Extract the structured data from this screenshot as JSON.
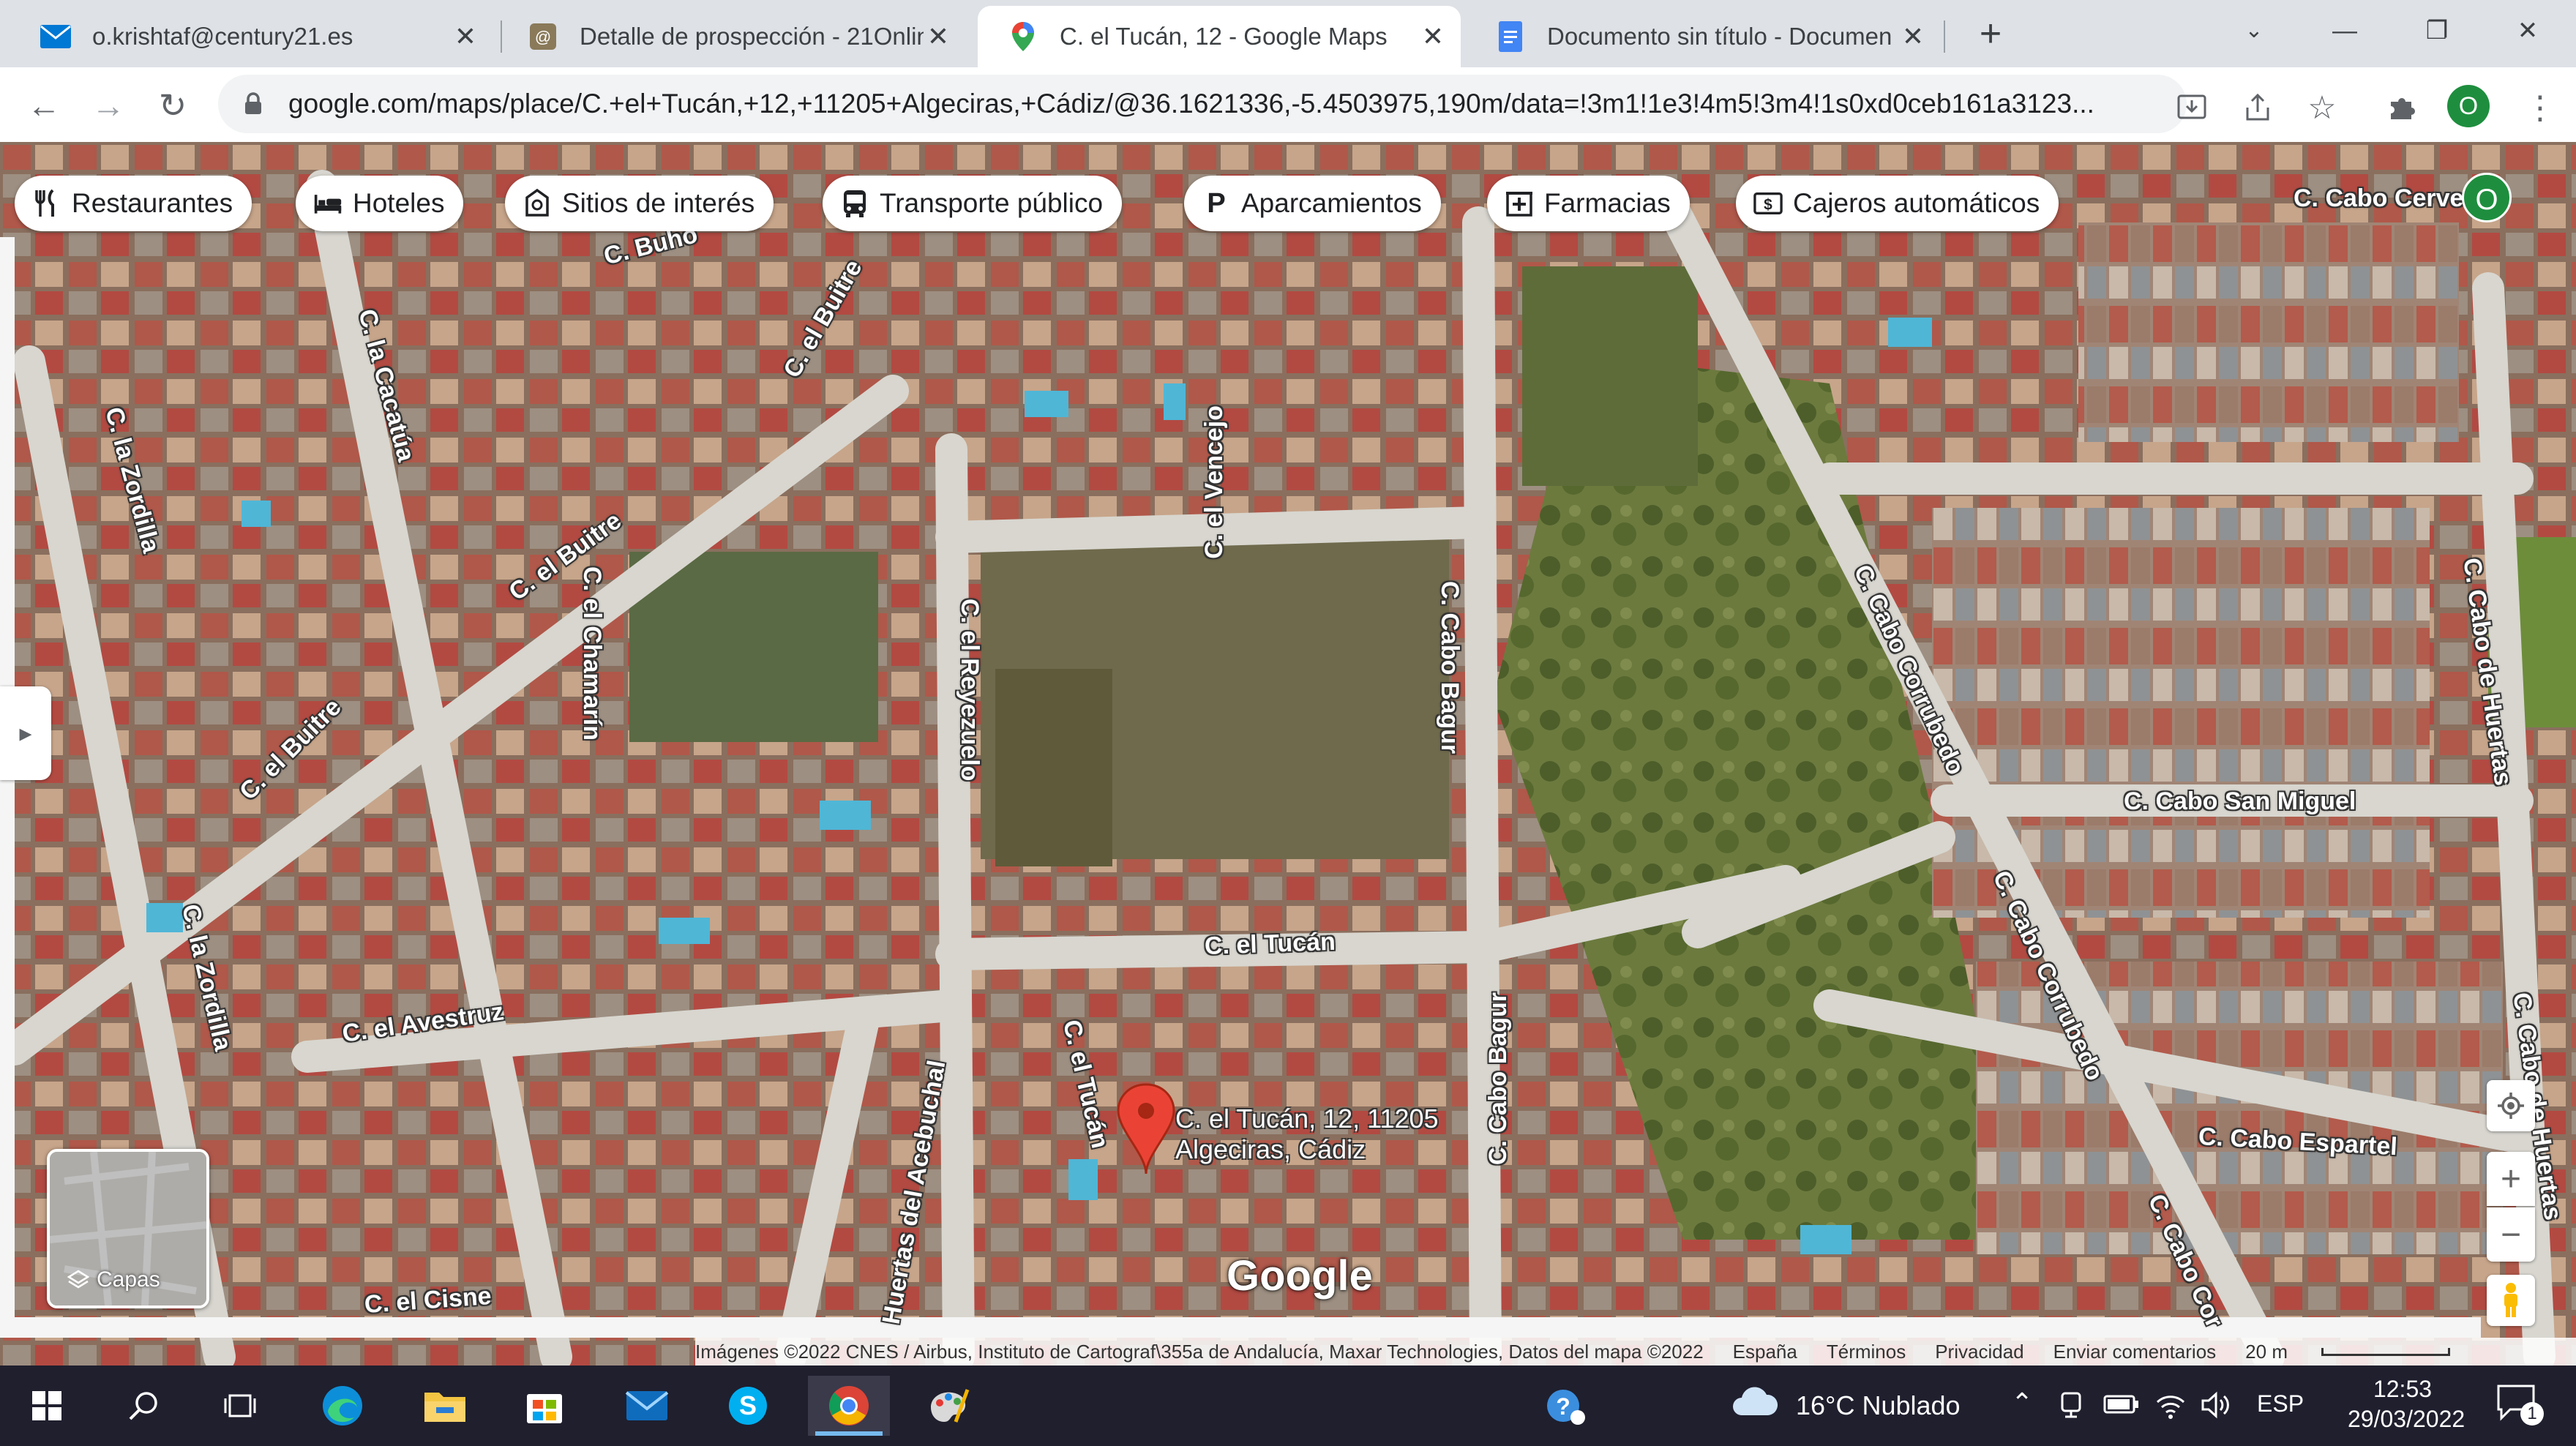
{
  "browser": {
    "tabs": [
      {
        "title": "o.krishtaf@century21.es",
        "icon": "mail-icon",
        "active": false
      },
      {
        "title": "Detalle de prospección - 21Onlin",
        "icon": "21online-icon",
        "active": false
      },
      {
        "title": "C. el Tucán, 12 - Google Maps",
        "icon": "maps-pin-icon",
        "active": true
      },
      {
        "title": "Documento sin título - Documen",
        "icon": "docs-icon",
        "active": false
      }
    ],
    "new_tab": "+",
    "url": "google.com/maps/place/C.+el+Tucán,+12,+11205+Algeciras,+Cádiz/@36.1621336,-5.4503975,190m/data=!3m1!1e3!4m5!3m4!1s0xd0ceb161a3123...",
    "profile_initial": "O"
  },
  "maps": {
    "categories": [
      {
        "label": "Restaurantes",
        "icon": "fork-knife-icon"
      },
      {
        "label": "Hoteles",
        "icon": "bed-icon"
      },
      {
        "label": "Sitios de interés",
        "icon": "landmark-icon"
      },
      {
        "label": "Transporte público",
        "icon": "bus-icon"
      },
      {
        "label": "Aparcamientos",
        "icon": "parking-icon"
      },
      {
        "label": "Farmacias",
        "icon": "pharmacy-icon"
      },
      {
        "label": "Cajeros automáticos",
        "icon": "atm-icon"
      }
    ],
    "account_initial": "O",
    "streets": [
      "C. Buho",
      "C. el Buitre",
      "C. el Vencejo",
      "C. la Cacatúa",
      "C. la Zordilla",
      "C. el Buitre",
      "C. el Chamarín",
      "C. el Reyezuelo",
      "C. Cabo Bagur",
      "C. Cabo Corrubedo",
      "C. Cabo Cerve",
      "C. Cabo de Huertas",
      "C. el Buitre",
      "C. Cabo San Miguel",
      "C. la Zordilla",
      "C. el Tucán",
      "C. el Avestruz",
      "C. el Tucán",
      "Huertas del Acebuchal",
      "C. Cabo Bagur",
      "C. Cabo Corrubedo",
      "C. Cabo Espartel",
      "C. Cabo Cor",
      "C. Cabo de Huertas",
      "C. el Cisne"
    ],
    "place_line1": "C. el Tucán, 12, 11205",
    "place_line2": "Algeciras, Cádiz",
    "layers_label": "Capas",
    "logo": "Google",
    "zoom_in": "+",
    "zoom_out": "−",
    "attribution": "Imágenes ©2022 CNES / Airbus, Instituto de Cartograf\\355a de Andalucía, Maxar Technologies, Datos del mapa ©2022",
    "footer_links": [
      "España",
      "Términos",
      "Privacidad",
      "Enviar comentarios"
    ],
    "scale": "20 m"
  },
  "taskbar": {
    "weather": "16°C  Nublado",
    "language": "ESP",
    "time": "12:53",
    "date": "29/03/2022",
    "notifications": "1"
  }
}
